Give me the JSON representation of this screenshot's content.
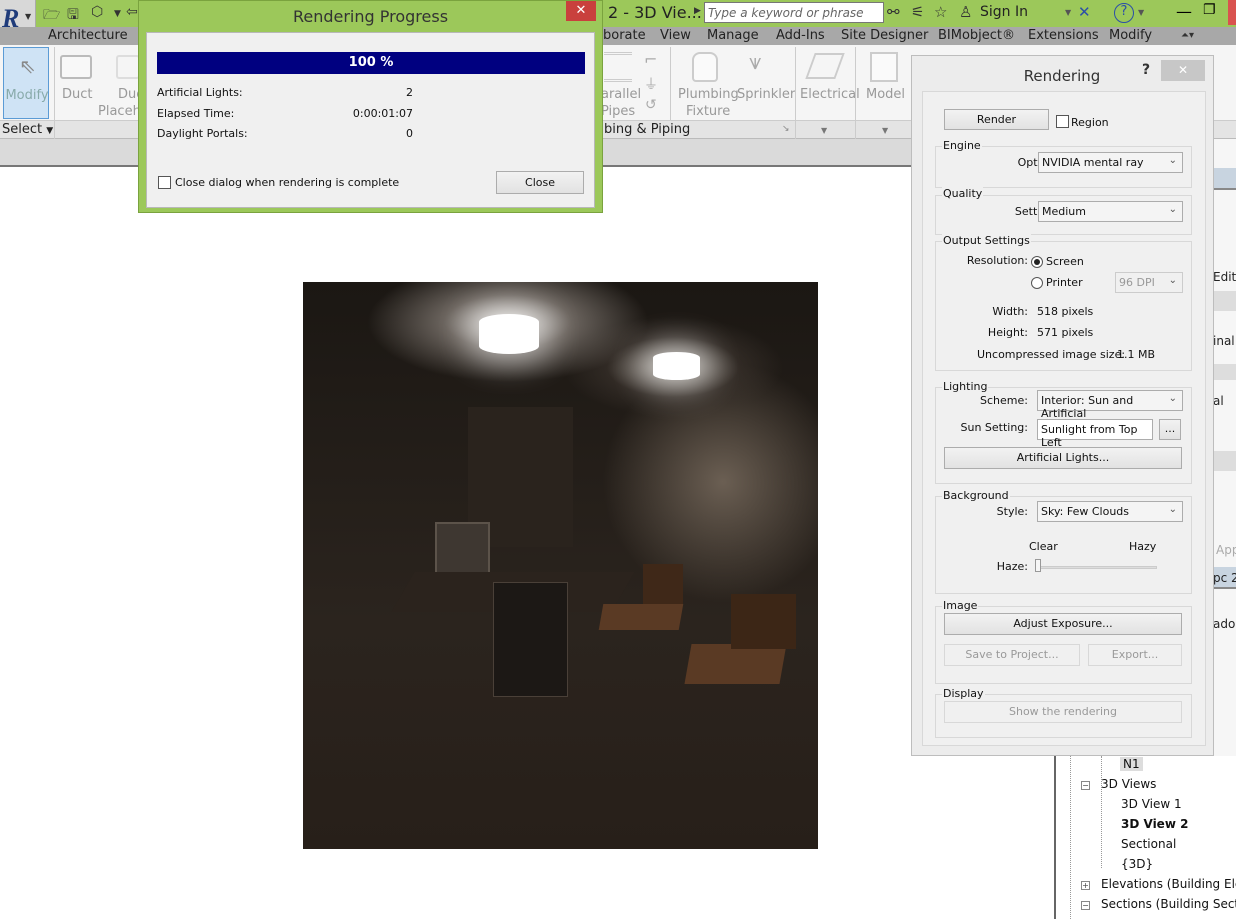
{
  "titlebar": {
    "doc_title": "2 - 3D Vie...",
    "search_placeholder": "Type a keyword or phrase",
    "sign_in": "Sign In",
    "icons": [
      "app-menu-icon",
      "open-icon",
      "save-icon",
      "sync-icon",
      "undo-icon",
      "binoculars-icon",
      "satellite-icon",
      "star-icon",
      "user-icon",
      "exchange-icon",
      "help-icon",
      "minimize-icon",
      "restore-icon",
      "close-icon"
    ]
  },
  "ribbon": {
    "tabs": [
      "Architecture",
      "borate",
      "View",
      "Manage",
      "Add-Ins",
      "Site Designer",
      "BIMobject®",
      "Extensions",
      "Modify"
    ],
    "buttons": {
      "modify": "Modify",
      "duct": "Duct",
      "duct_placeholder_1": "Duc",
      "duct_placeholder_2": "Placeho",
      "parallel_1": "arallel",
      "parallel_2": "Pipes",
      "plumbing_1": "Plumbing",
      "plumbing_2": "Fixture",
      "sprinkler": "Sprinkler",
      "electrical": "Electrical",
      "model": "Model"
    },
    "panels": {
      "select": "Select",
      "plumbing_piping": "bing & Piping"
    }
  },
  "progress_dialog": {
    "title": "Rendering Progress",
    "percent_label": "100 %",
    "progress": 1.0,
    "rows": [
      {
        "label": "Artificial Lights:",
        "value": "2"
      },
      {
        "label": "Elapsed Time:",
        "value": "0:00:01:07"
      },
      {
        "label": "Daylight Portals:",
        "value": "0"
      }
    ],
    "close_when_complete_label": "Close dialog when rendering is complete",
    "close_when_complete_checked": false,
    "close_button": "Close"
  },
  "rendering_dialog": {
    "title": "Rendering",
    "help": "?",
    "render_button": "Render",
    "region_label": "Region",
    "region_checked": false,
    "engine": {
      "group": "Engine",
      "label": "Option:",
      "value": "NVIDIA mental ray"
    },
    "quality": {
      "group": "Quality",
      "label": "Setting:",
      "value": "Medium"
    },
    "output": {
      "group": "Output Settings",
      "resolution_label": "Resolution:",
      "screen_label": "Screen",
      "printer_label": "Printer",
      "selected": "Screen",
      "dpi": "96 DPI",
      "width_label": "Width:",
      "width_value": "518 pixels",
      "height_label": "Height:",
      "height_value": "571 pixels",
      "size_label": "Uncompressed image size:",
      "size_value": "1.1 MB"
    },
    "lighting": {
      "group": "Lighting",
      "scheme_label": "Scheme:",
      "scheme_value": "Interior: Sun and Artificial",
      "sun_label": "Sun Setting:",
      "sun_value": "Sunlight from Top Left",
      "sun_more": "...",
      "artificial_button": "Artificial Lights..."
    },
    "background": {
      "group": "Background",
      "style_label": "Style:",
      "style_value": "Sky: Few Clouds",
      "clear_label": "Clear",
      "hazy_label": "Hazy",
      "haze_label": "Haze:",
      "haze_value": 0
    },
    "image": {
      "group": "Image",
      "adjust_button": "Adjust Exposure...",
      "save_button": "Save to Project...",
      "export_button": "Export..."
    },
    "display": {
      "group": "Display",
      "show_button": "Show the rendering"
    }
  },
  "right_panel": {
    "fragments": [
      "Edit",
      "inal",
      "al",
      "App",
      "pc 2",
      "ado)"
    ]
  },
  "project_browser": {
    "items": [
      {
        "label": "N1",
        "level": 2,
        "selected": true
      },
      {
        "label": "3D Views",
        "level": 1,
        "toggle": "minus"
      },
      {
        "label": "3D View 1",
        "level": 2
      },
      {
        "label": "3D View 2",
        "level": 2,
        "bold": true
      },
      {
        "label": "Sectional",
        "level": 2
      },
      {
        "label": "{3D}",
        "level": 2
      },
      {
        "label": "Elevations (Building Elev",
        "level": 1,
        "toggle": "plus"
      },
      {
        "label": "Sections (Building Sectio",
        "level": 1,
        "toggle": "minus"
      }
    ]
  }
}
